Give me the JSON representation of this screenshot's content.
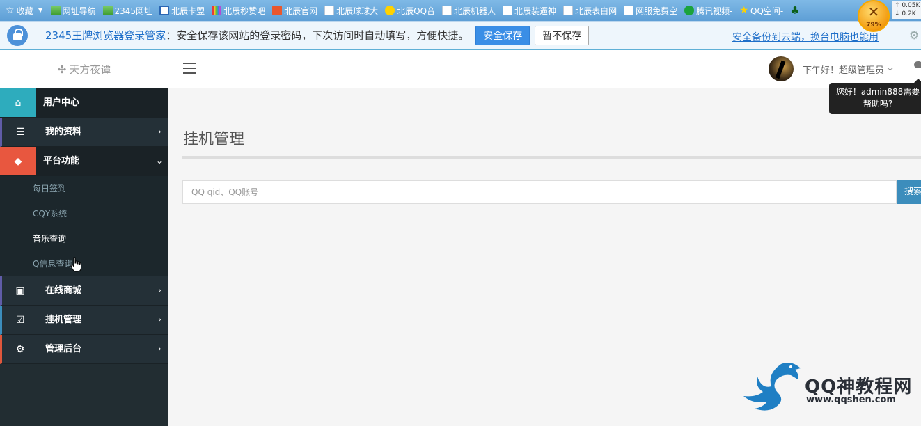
{
  "favorites_bar": {
    "collect_label": "收藏",
    "items": [
      {
        "label": "网址导航",
        "icon": "house-icon"
      },
      {
        "label": "2345网址",
        "icon": "house-icon"
      },
      {
        "label": "北辰卡盟",
        "icon": "windows-icon"
      },
      {
        "label": "北辰秒赞吧",
        "icon": "bars-icon"
      },
      {
        "label": "北辰官网",
        "icon": "home-icon"
      },
      {
        "label": "北辰球球大",
        "icon": "page-icon"
      },
      {
        "label": "北辰QQ音",
        "icon": "qq-music-icon"
      },
      {
        "label": "北辰机器人",
        "icon": "page-icon"
      },
      {
        "label": "北辰装逼神",
        "icon": "page-icon"
      },
      {
        "label": "北辰表白网",
        "icon": "page-icon"
      },
      {
        "label": "网服免费空",
        "icon": "page-icon"
      },
      {
        "label": "腾讯视频-",
        "icon": "play-icon"
      },
      {
        "label": "QQ空间-",
        "icon": "star-icon"
      }
    ],
    "net_up": "0.05K",
    "net_down": "0.2K",
    "speed_percent": "79%"
  },
  "password_bar": {
    "title": "2345王牌浏览器登录管家",
    "message": "：安全保存该网站的登录密码，下次访问时自动填写，方便快捷。",
    "save_label": "安全保存",
    "nosave_label": "暂不保存",
    "link_text": "安全备份到云端，换台电脑也能用"
  },
  "header": {
    "brand": "天方夜谭",
    "greeting": "下午好！超级管理员",
    "tooltip": "您好！admin888需要帮助吗?"
  },
  "sidebar": {
    "items": [
      {
        "label": "用户中心",
        "icon": "home-icon"
      },
      {
        "label": "我的资料",
        "icon": "list-icon"
      },
      {
        "label": "平台功能",
        "icon": "tags-icon"
      },
      {
        "label": "在线商城",
        "icon": "gift-icon"
      },
      {
        "label": "挂机管理",
        "icon": "checkbox-icon"
      },
      {
        "label": "管理后台",
        "icon": "gear-icon"
      }
    ],
    "platform_sub": [
      "每日签到",
      "CQY系统",
      "音乐查询",
      "Q信息查询"
    ]
  },
  "main": {
    "page_title": "挂机管理",
    "search_placeholder": "QQ qid、QQ账号",
    "search_button": "搜索"
  },
  "watermark": {
    "title": "QQ神教程网",
    "url": "www.qqshen.com"
  }
}
